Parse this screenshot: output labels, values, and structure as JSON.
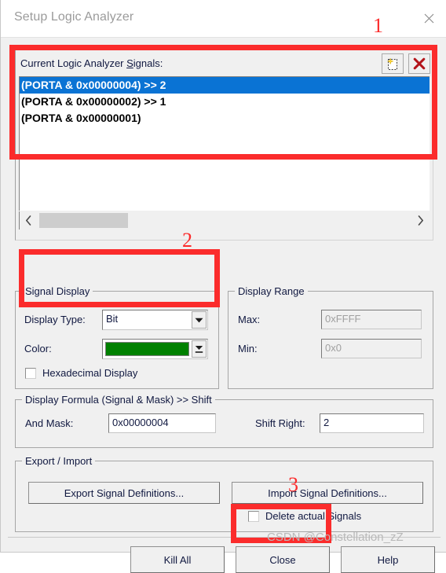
{
  "window": {
    "title": "Setup Logic Analyzer",
    "close_icon": "close-icon"
  },
  "signals": {
    "label_prefix": "Current Logic Analyzer ",
    "label_accel": "S",
    "label_suffix": "ignals:",
    "full_label": "Current Logic Analyzer Signals:",
    "new_icon": "new-signal-icon",
    "delete_icon": "delete-signal-icon",
    "items": [
      {
        "text": "(PORTA & 0x00000004) >> 2",
        "selected": true
      },
      {
        "text": "(PORTA & 0x00000002) >> 1",
        "selected": false
      },
      {
        "text": "(PORTA & 0x00000001)",
        "selected": false
      }
    ],
    "scroll_left_icon": "chevron-left-icon",
    "scroll_right_icon": "chevron-right-icon"
  },
  "signal_display": {
    "legend": "Signal Display",
    "display_type_label": "Display Type:",
    "display_type_value": "Bit",
    "color_label": "Color:",
    "color_value": "#008000",
    "hex_checkbox_label": "Hexadecimal Display",
    "hex_checkbox_checked": false,
    "dropdown_icon": "chevron-down-icon",
    "color_dropdown_icon": "color-dropdown-icon"
  },
  "display_range": {
    "legend": "Display Range",
    "max_label": "Max:",
    "max_value": "0xFFFF",
    "min_label": "Min:",
    "min_value": "0x0",
    "disabled": true
  },
  "display_formula": {
    "legend": "Display Formula (Signal & Mask) >> Shift",
    "and_mask_label": "And Mask:",
    "and_mask_value": "0x00000004",
    "shift_right_label": "Shift Right:",
    "shift_right_value": "2"
  },
  "export_import": {
    "legend": "Export / Import",
    "export_button": "Export Signal Definitions...",
    "import_button": "Import Signal Definitions...",
    "delete_checkbox_label": "Delete actual Signals",
    "delete_checkbox_checked": false
  },
  "footer": {
    "kill_all": "Kill All",
    "close": "Close",
    "help": "Help"
  },
  "annotations": {
    "color": "#fb2c2c",
    "marker_1": "1",
    "marker_2": "2",
    "marker_3": "3"
  },
  "watermark": "CSDN @Constellation_zZ"
}
